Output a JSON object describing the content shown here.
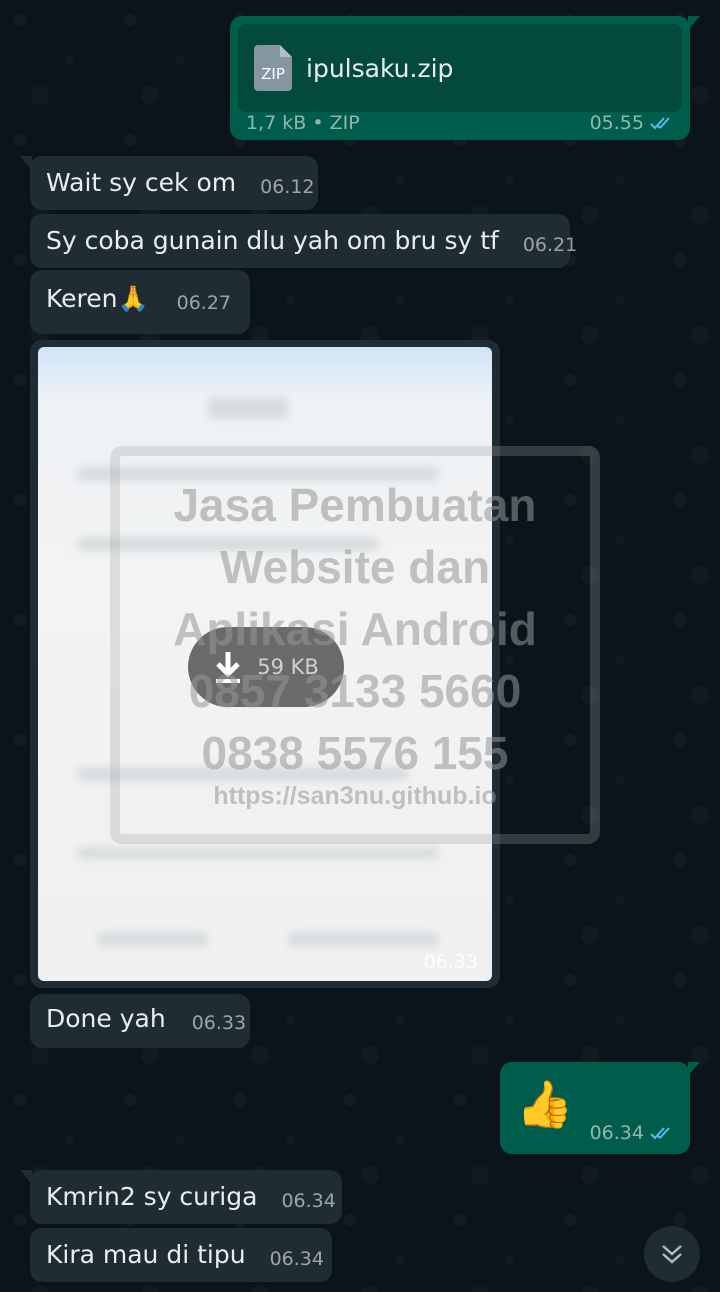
{
  "file_message": {
    "file_type_badge": "ZIP",
    "file_name": "ipulsaku.zip",
    "file_meta": "1,7 kB • ZIP",
    "time": "05.55",
    "status": "read"
  },
  "messages": [
    {
      "id": "m1",
      "text": "Wait sy cek om",
      "time": "06.12"
    },
    {
      "id": "m2",
      "text": "Sy coba gunain dlu yah om bru sy tf",
      "time": "06.21"
    },
    {
      "id": "m3",
      "text": "Keren🙏",
      "time": "06.27"
    },
    {
      "id": "m4",
      "text": "Done yah",
      "time": "06.33"
    },
    {
      "id": "m5",
      "text": "👍",
      "time": "06.34"
    },
    {
      "id": "m6",
      "text": "Kmrin2 sy curiga",
      "time": "06.34"
    },
    {
      "id": "m7",
      "text": "Kira mau di tipu",
      "time": "06.34"
    }
  ],
  "image_message": {
    "download_size": "59 KB",
    "time": "06.33"
  },
  "watermark": {
    "line1": "Jasa Pembuatan",
    "line2": "Website dan",
    "line3": "Aplikasi Android",
    "line4": "0857 3133 5660",
    "line5": "0838 5576 155",
    "line6": "https://san3nu.github.io"
  },
  "colors": {
    "background": "#0b141a",
    "incoming_bubble": "#202c33",
    "outgoing_bubble": "#005c4b",
    "read_ticks": "#53bdeb"
  },
  "icons": {
    "read_ticks": "double-check-icon",
    "download": "download-arrow-icon",
    "scroll_down": "double-chevron-down-icon"
  }
}
